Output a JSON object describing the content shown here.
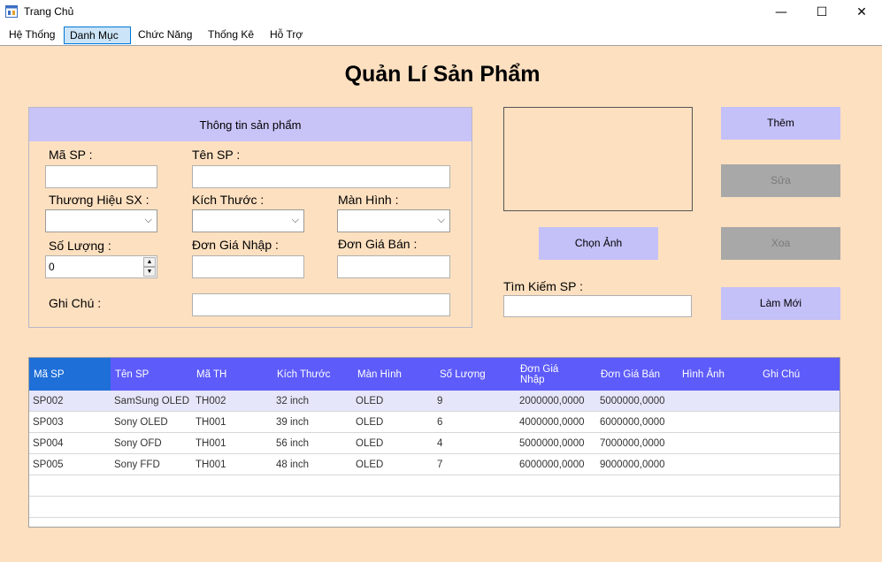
{
  "window": {
    "title": "Trang Chủ",
    "minimize": "—",
    "maximize": "☐",
    "close": "✕"
  },
  "menu": {
    "items": [
      "Hệ Thống",
      "Danh Mục",
      "Chức Năng",
      "Thống Kê",
      "Hỗ Trợ"
    ],
    "active_index": 1
  },
  "page": {
    "title": "Quản Lí Sản Phẩm"
  },
  "info_panel": {
    "header": "Thông tin sản phẩm",
    "labels": {
      "ma_sp": "Mã SP :",
      "ten_sp": "Tên SP :",
      "thuong_hieu": "Thương Hiệu SX :",
      "kich_thuoc": "Kích Thước :",
      "man_hinh": "Màn Hình :",
      "so_luong": "Số Lượng :",
      "don_gia_nhap": "Đơn Giá Nhập :",
      "don_gia_ban": "Đơn Giá Bán :",
      "ghi_chu": "Ghi Chú :"
    },
    "values": {
      "so_luong": "0"
    }
  },
  "actions": {
    "them": "Thêm",
    "sua": "Sửa",
    "xoa": "Xoa",
    "lam_moi": "Làm Mới",
    "chon_anh": "Chọn Ảnh",
    "tim_kiem_label": "Tìm Kiếm SP :"
  },
  "grid": {
    "columns": [
      "Mã SP",
      "Tên SP",
      "Mã TH",
      "Kích Thước",
      "Màn Hình",
      "Số Lượng",
      "Đơn Giá Nhập",
      "Đơn Giá Bán",
      "Hình Ảnh",
      "Ghi Chú"
    ],
    "rows": [
      [
        "SP002",
        "SamSung OLED",
        "TH002",
        "32 inch",
        "OLED",
        "9",
        "2000000,0000",
        "5000000,0000",
        "",
        ""
      ],
      [
        "SP003",
        "Sony OLED",
        "TH001",
        "39 inch",
        "OLED",
        "6",
        "4000000,0000",
        "6000000,0000",
        "",
        ""
      ],
      [
        "SP004",
        "Sony OFD",
        "TH001",
        "56 inch",
        "OLED",
        "4",
        "5000000,0000",
        "7000000,0000",
        "",
        ""
      ],
      [
        "SP005",
        "Sony FFD",
        "TH001",
        "48 inch",
        "OLED",
        "7",
        "6000000,0000",
        "9000000,0000",
        "",
        ""
      ]
    ]
  },
  "colors": {
    "background": "#fde0c0",
    "panel_header": "#c8c4f8",
    "grid_header": "#5d5bfa",
    "disabled_button": "#a8a8a8"
  }
}
